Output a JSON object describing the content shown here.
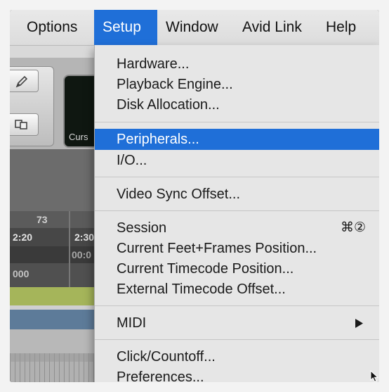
{
  "menubar": {
    "items": [
      "Options",
      "Setup",
      "Window",
      "Avid Link",
      "Help"
    ],
    "active": "Setup"
  },
  "background": {
    "counter_label": "Curs",
    "bar_ruler": [
      "73"
    ],
    "timecode_ruler": [
      "2:20",
      "2:30"
    ],
    "dark_ruler": [
      "00:0"
    ],
    "feet_ruler": [
      "000"
    ]
  },
  "setup_menu": {
    "group1": [
      "Hardware...",
      "Playback Engine...",
      "Disk Allocation..."
    ],
    "group2": [
      "Peripherals...",
      "I/O..."
    ],
    "highlighted": "Peripherals...",
    "group3": [
      "Video Sync Offset..."
    ],
    "group4": [
      "Session",
      "Current Feet+Frames Position...",
      "Current Timecode Position...",
      "External Timecode Offset..."
    ],
    "session_shortcut": "⌘②",
    "group5": [
      "MIDI"
    ],
    "midi_has_submenu": true,
    "group6": [
      "Click/Countoff...",
      "Preferences..."
    ]
  },
  "colors": {
    "highlight": "#1f6fd8",
    "menu_bg": "#e6e6e6",
    "marker_lane": "#a5b55a",
    "track_lane": "#5d7b99"
  },
  "icons": [
    "pencil-icon",
    "grabber-icon",
    "submenu-arrow-icon",
    "mouse-cursor-icon"
  ]
}
